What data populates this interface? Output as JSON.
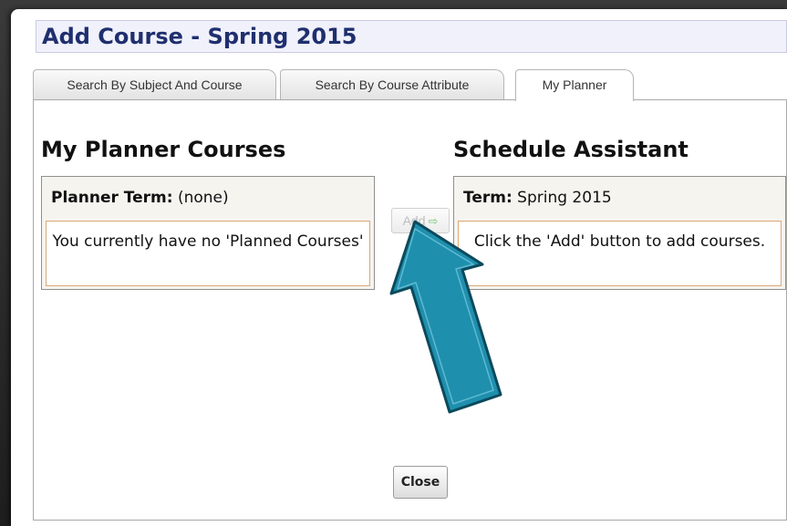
{
  "dialog": {
    "title": "Add Course - Spring 2015"
  },
  "tabs": [
    {
      "label": "Search By Subject And Course",
      "active": false
    },
    {
      "label": "Search By Course Attribute",
      "active": false
    },
    {
      "label": "My Planner",
      "active": true
    }
  ],
  "planner": {
    "heading": "My Planner Courses",
    "term_label": "Planner Term:",
    "term_value": "(none)",
    "message": "You currently have no 'Planned Courses'"
  },
  "add_button": {
    "label": "Add",
    "icon": "arrow-right-icon",
    "enabled": false
  },
  "schedule": {
    "heading": "Schedule Assistant",
    "term_label": "Term:",
    "term_value": "Spring 2015",
    "message": "Click the 'Add' button to add courses."
  },
  "close_button": {
    "label": "Close"
  },
  "annotation": {
    "icon": "callout-arrow-icon",
    "color": "#1f8fae",
    "outline": "#0b4a5c",
    "points_to": "add-button"
  },
  "colors": {
    "title_text": "#1f2f6e",
    "title_bg": "#f0f1fb",
    "message_border": "#d9a878"
  }
}
